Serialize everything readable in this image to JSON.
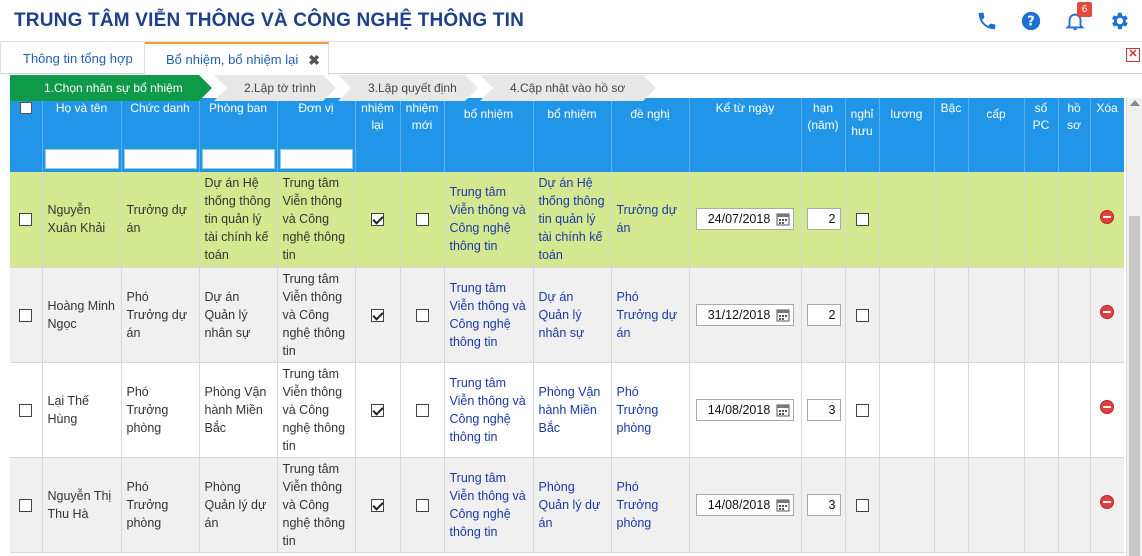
{
  "app": {
    "title": "TRUNG TÂM VIỄN THÔNG VÀ CÔNG NGHỆ THÔNG TIN",
    "notification_count": "6"
  },
  "tabs": [
    {
      "label": "Thông tin tổng hợp"
    },
    {
      "label": "Bổ nhiệm, bổ nhiệm lại",
      "close": "✖"
    }
  ],
  "tab_close_red": "✕",
  "steps": [
    "1.Chọn nhân sự bổ nhiệm",
    "2.Lập tờ trình",
    "3.Lập quyết định",
    "4.Cập nhật vào hồ sơ"
  ],
  "columns": {
    "ho_ten": "Họ và tên",
    "chuc_danh": "Chức danh",
    "phong_ban": "Phòng ban",
    "don_vi": "Đơn vị",
    "bn_lai": "nhiệm lại",
    "bn_moi": "nhiệm mới",
    "dv_bn": "bổ nhiệm",
    "pb_bn": "bổ nhiệm",
    "cd_dn": "đề nghị",
    "ke_tu_ngay": "Kể từ ngày",
    "thoi_han": "hạn (năm)",
    "nghi_huu": "nghỉ hưu",
    "luong": "lương",
    "bac": "Bậc",
    "cap": "cấp",
    "so_pc": "số PC",
    "ho_so": "hồ sơ",
    "xoa": "Xóa"
  },
  "rows": [
    {
      "ho_ten": "Nguyễn Xuân Khải",
      "chuc_danh": "Trưởng dự án",
      "phong_ban": "Dự án Hệ thống thông tin quản lý tài chính kế toán",
      "don_vi": "Trung tâm Viễn thông và Công nghệ thông tin",
      "bn_lai": true,
      "bn_moi": false,
      "dv_bn": "Trung tâm Viễn thông và Công nghệ thông tin",
      "pb_bn": "Dự án Hệ thống thông tin quản lý tài chính kế toán",
      "cd_dn": "Trưởng dự án",
      "ke_tu_ngay": "24/07/2018",
      "thoi_han": "2",
      "nghi_huu": false
    },
    {
      "ho_ten": "Hoàng Minh Ngọc",
      "chuc_danh": "Phó Trưởng dự án",
      "phong_ban": "Dự án Quản lý nhân sự",
      "don_vi": "Trung tâm Viễn thông và Công nghệ thông tin",
      "bn_lai": true,
      "bn_moi": false,
      "dv_bn": "Trung tâm Viễn thông và Công nghệ thông tin",
      "pb_bn": "Dự án Quản lý nhân sự",
      "cd_dn": "Phó Trưởng dự án",
      "ke_tu_ngay": "31/12/2018",
      "thoi_han": "2",
      "nghi_huu": false
    },
    {
      "ho_ten": "Lại Thế Hùng",
      "chuc_danh": "Phó Trưởng phòng",
      "phong_ban": "Phòng Vận hành Miền Bắc",
      "don_vi": "Trung tâm Viễn thông và Công nghệ thông tin",
      "bn_lai": true,
      "bn_moi": false,
      "dv_bn": "Trung tâm Viễn thông và Công nghệ thông tin",
      "pb_bn": "Phòng Vận hành Miền Bắc",
      "cd_dn": "Phó Trưởng phòng",
      "ke_tu_ngay": "14/08/2018",
      "thoi_han": "3",
      "nghi_huu": false
    },
    {
      "ho_ten": "Nguyễn Thị Thu Hà",
      "chuc_danh": "Phó Trưởng phòng",
      "phong_ban": "Phòng Quản lý dự án",
      "don_vi": "Trung tâm Viễn thông và Công nghệ thông tin",
      "bn_lai": true,
      "bn_moi": false,
      "dv_bn": "Trung tâm Viễn thông và Công nghệ thông tin",
      "pb_bn": "Phòng Quản lý dự án",
      "cd_dn": "Phó Trưởng phòng",
      "ke_tu_ngay": "14/08/2018",
      "thoi_han": "3",
      "nghi_huu": false
    }
  ],
  "icons": {
    "phone": "phone-icon",
    "help": "help-icon",
    "bell": "bell-icon",
    "settings": "gear-icon",
    "calendar": "calendar-icon",
    "delete": "delete-icon"
  },
  "colors": {
    "header_blue": "#2196e8",
    "selected_row": "#d4e98f",
    "active_step": "#0f9a4a",
    "title": "#1f3f8a"
  }
}
